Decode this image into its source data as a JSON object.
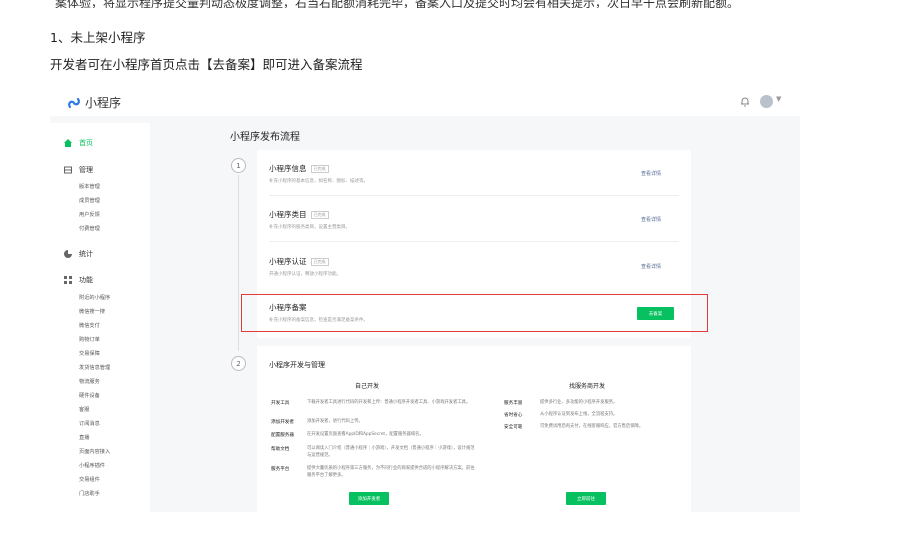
{
  "doc": {
    "cut_text": "案体验，将显示程序提交量判动态极度调整，右当右配额消耗完毕，备案入口及提交时均会有相关提示，次日早干点会刷新配额。",
    "heading": "1、未上架小程序",
    "instruction": "开发者可在小程序首页点击【去备案】即可进入备案流程"
  },
  "app": {
    "logo_text": "小程序",
    "brand_color": "#07c160",
    "highlight_color": "#e23b3b"
  },
  "sidebar": {
    "home": "首页",
    "manage": "管理",
    "manage_items": [
      "版本管理",
      "成员管理",
      "用户反馈",
      "付费管理"
    ],
    "stats": "统计",
    "features": "功能",
    "feature_items": [
      "附近的小程序",
      "微信搜一搜",
      "微信支付",
      "购物订单",
      "交易保障",
      "发货信息管理",
      "物流服务",
      "硬件设备",
      "客服",
      "订阅消息",
      "直播",
      "页面内容接入",
      "小程序插件",
      "交易组件",
      "门店助手"
    ]
  },
  "main": {
    "title": "小程序发布流程",
    "step1_num": "1",
    "step2_num": "2",
    "rows": [
      {
        "title": "小程序信息",
        "tag": "已完成",
        "desc": "补充小程序的基本信息，如名称、图标、描述等。",
        "link": "查看详情"
      },
      {
        "title": "小程序类目",
        "tag": "已完成",
        "desc": "补充小程序的服务类目，设置主营类目。",
        "link": "查看详情"
      },
      {
        "title": "小程序认证",
        "tag": "已完成",
        "desc": "开通小程序认证，释放小程序功能。",
        "link": "查看详情"
      }
    ],
    "filing": {
      "title": "小程序备案",
      "desc": "补充小程序的备案信息，检查是否满足备案条件。",
      "button": "去备案"
    },
    "dev": {
      "title": "小程序开发与管理",
      "left_head": "自己开发",
      "right_head": "找服务商开发",
      "left_items": [
        {
          "key": "开发工具",
          "val": "下载开发者工具进行代码的开发和上传：普通小程序开发者工具、小游戏开发者工具。"
        },
        {
          "key": "添加开发者",
          "val": "添加开发者，进行代码上传。"
        },
        {
          "key": "配置服务器",
          "val": "在开发设置页面查看AppID和AppSecret，配置服务器域名。"
        },
        {
          "key": "帮助文档",
          "val": "可以阅读入门介绍（普通小程序｜小游戏），开发文档（普通小程序｜小游戏），设计规范与运营规范。"
        },
        {
          "key": "服务平台",
          "val": "提供大量优质的小程序第三方服务，为不同行业的商家提供合适的小程序解决方案。前往服务平台了解更多。"
        }
      ],
      "right_items": [
        {
          "key": "服务丰富",
          "val": "提供多行业、多功能的小程序开发服务。"
        },
        {
          "key": "省时省心",
          "val": "从小程序认证到发布上线，全流程支持。"
        },
        {
          "key": "安全可靠",
          "val": "可免费试用后再支付，在线客服响应，官方售后保障。"
        }
      ],
      "left_button": "添加开发者",
      "right_button": "立即前往"
    }
  }
}
